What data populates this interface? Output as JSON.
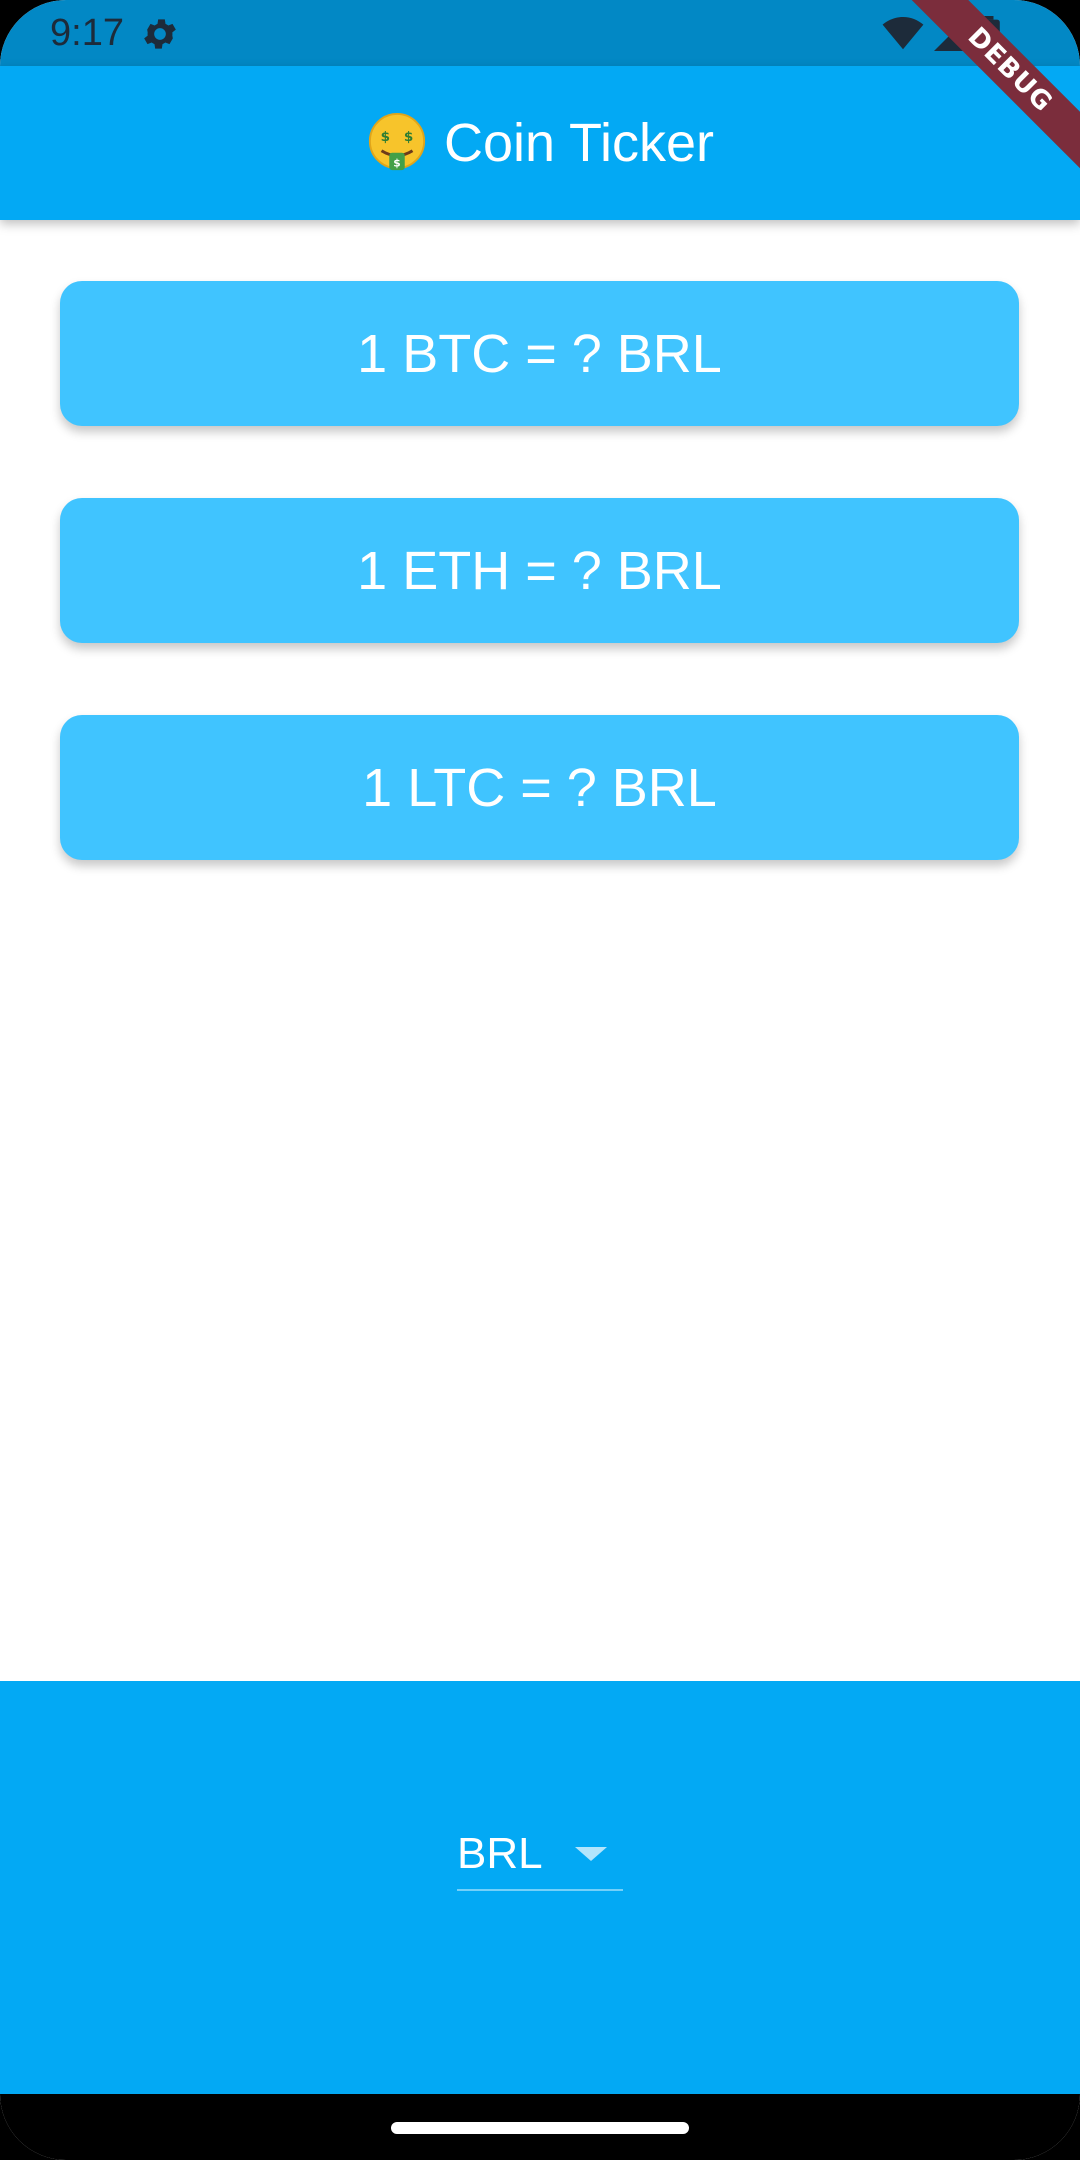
{
  "status_bar": {
    "time": "9:17",
    "icons": [
      "gear-icon",
      "wifi-icon",
      "signal-icon",
      "battery-icon"
    ]
  },
  "app_bar": {
    "emoji": "money-mouth-face-icon",
    "title": "Coin Ticker"
  },
  "rates": [
    {
      "label": "1 BTC = ? BRL"
    },
    {
      "label": "1 ETH = ? BRL"
    },
    {
      "label": "1 LTC = ? BRL"
    }
  ],
  "currency_picker": {
    "selected": "BRL"
  },
  "debug_banner": "DEBUG",
  "colors": {
    "primary": "#03a9f4",
    "card": "#40c4ff",
    "status_bar": "#0288c5",
    "debug": "#7b2d3c"
  }
}
